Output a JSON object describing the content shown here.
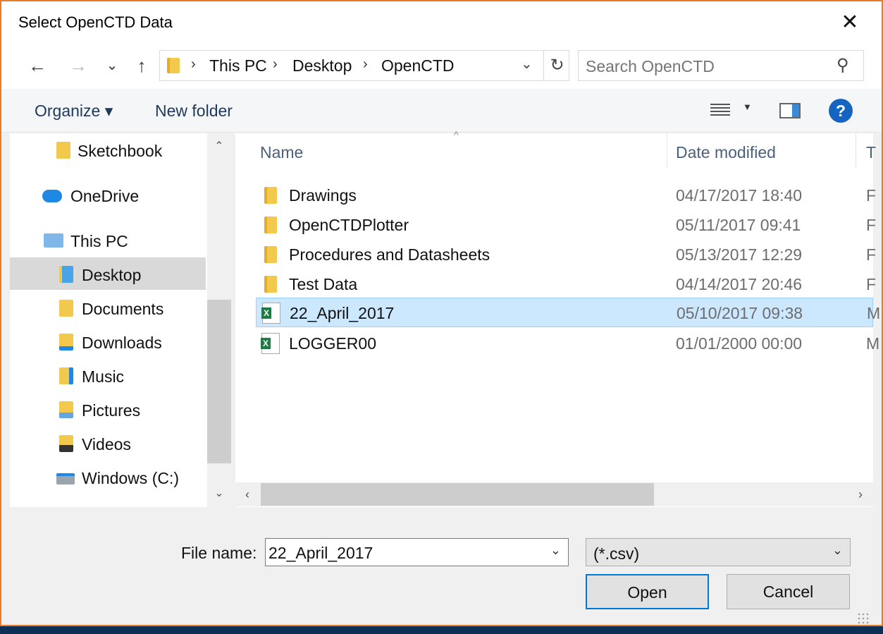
{
  "window": {
    "title": "Select OpenCTD Data",
    "close_glyph": "✕"
  },
  "nav": {
    "back_glyph": "←",
    "forward_glyph": "→",
    "recent_glyph": "⌄",
    "up_glyph": "↑",
    "breadcrumb": [
      "This PC",
      "Desktop",
      "OpenCTD"
    ],
    "breadcrumb_sep": "›",
    "refresh_glyph": "↻",
    "dropdown_glyph": "⌄",
    "search_placeholder": "Search OpenCTD",
    "search_glyph": "⚲"
  },
  "toolbar": {
    "organize": "Organize ▾",
    "new_folder": "New folder",
    "help": "?",
    "view_drop": "▼"
  },
  "sidebar": {
    "items": [
      {
        "label": "Sketchbook",
        "icon": "folder-icon"
      },
      {
        "label": "OneDrive",
        "icon": "onedrive-icon"
      },
      {
        "label": "This PC",
        "icon": "computer-icon"
      },
      {
        "label": "Desktop",
        "icon": "desktop-icon",
        "selected": true
      },
      {
        "label": "Documents",
        "icon": "documents-icon"
      },
      {
        "label": "Downloads",
        "icon": "downloads-icon"
      },
      {
        "label": "Music",
        "icon": "music-icon"
      },
      {
        "label": "Pictures",
        "icon": "pictures-icon"
      },
      {
        "label": "Videos",
        "icon": "videos-icon"
      },
      {
        "label": "Windows (C:)",
        "icon": "drive-icon"
      }
    ],
    "scroll_up": "⌃",
    "scroll_down": "⌄"
  },
  "files": {
    "columns": {
      "name": "Name",
      "date": "Date modified",
      "type": "T"
    },
    "sort_caret": "^",
    "rows": [
      {
        "name": "Drawings",
        "date": "04/17/2017 18:40",
        "type": "F",
        "kind": "folder"
      },
      {
        "name": "OpenCTDPlotter",
        "date": "05/11/2017 09:41",
        "type": "F",
        "kind": "folder"
      },
      {
        "name": "Procedures and Datasheets",
        "date": "05/13/2017 12:29",
        "type": "F",
        "kind": "folder"
      },
      {
        "name": "Test Data",
        "date": "04/14/2017 20:46",
        "type": "F",
        "kind": "folder"
      },
      {
        "name": "22_April_2017",
        "date": "05/10/2017 09:38",
        "type": "M",
        "kind": "excel",
        "selected": true
      },
      {
        "name": "LOGGER00",
        "date": "01/01/2000 00:00",
        "type": "M",
        "kind": "excel"
      }
    ],
    "excel_letter": "X",
    "scroll_left": "‹",
    "scroll_right": "›"
  },
  "footer": {
    "file_name_label": "File name:",
    "file_name_value": "22_April_2017",
    "file_type_value": "(*.csv)",
    "dropdown_glyph": "⌄",
    "open_label": "Open",
    "cancel_label": "Cancel"
  },
  "colors": {
    "accent": "#0078d7",
    "selection": "#cce8ff",
    "border": "#e87b2c",
    "folder": "#f2c94c"
  }
}
